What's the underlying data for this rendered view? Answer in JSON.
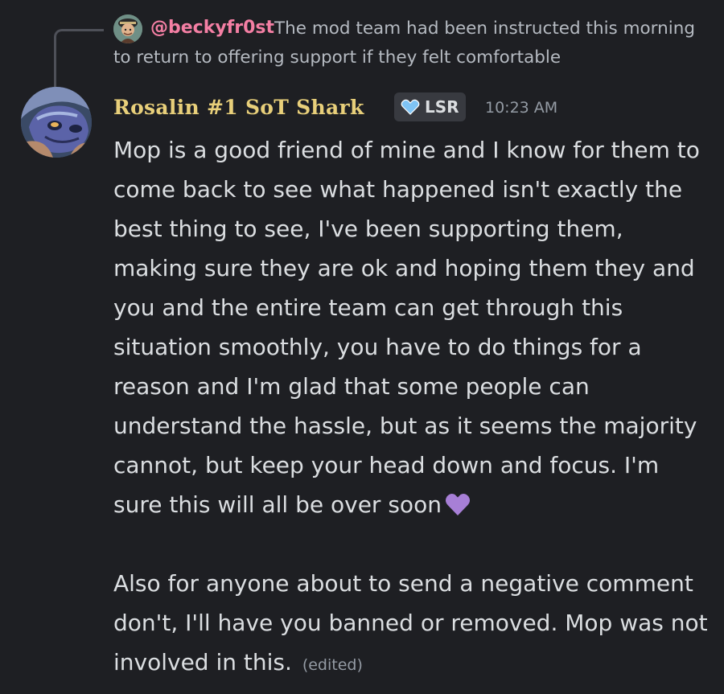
{
  "reply": {
    "author": "@beckyfr0st",
    "text": "The mod team had been instructed this morning to return to offering support if they felt comfortable"
  },
  "message": {
    "author": "Rosalin #1 SoT Shark",
    "tag": {
      "label": "LSR",
      "icon": "heart-shield-icon"
    },
    "timestamp": "10:23 AM",
    "paragraph_1": "Mop is a good friend of mine and I know for them to come back to see what happened isn't exactly the best thing to see, I've been supporting them, making sure they are ok and hoping them they and you and the entire team can get through this situation smoothly, you have to do things for a reason and I'm glad that some people can understand the hassle, but as it seems the majority cannot, but keep your head down and focus. I'm sure this will all be over soon",
    "emoji": "purple-heart-icon",
    "paragraph_2": "Also for anyone about to send a negative comment don't, I'll have you banned or removed. Mop was not involved in this.",
    "edited_label": "(edited)"
  },
  "colors": {
    "background": "#1e1f23",
    "reply_author": "#f47fa4",
    "author": "#e8cf7a",
    "text": "#dbdee1",
    "muted": "#949ba4",
    "heart": "#a77fd6"
  }
}
